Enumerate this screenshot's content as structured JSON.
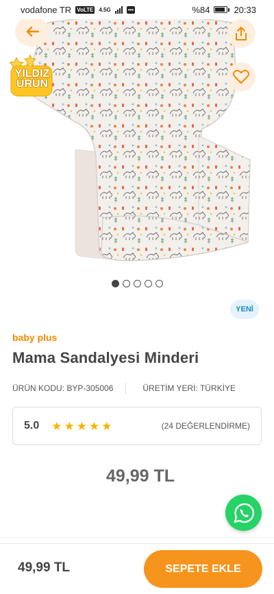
{
  "status_bar": {
    "carrier": "vodafone TR",
    "volte": "VoLTE",
    "network": "4.5G",
    "battery": "%84",
    "time": "20:33"
  },
  "header": {
    "back_icon": "arrow-left-icon",
    "share_icon": "share-icon",
    "favorite_icon": "heart-icon"
  },
  "badge": {
    "line1": "YILDIZ",
    "line2": "ÜRÜN"
  },
  "gallery": {
    "image_count": 5,
    "active_index": 0
  },
  "product": {
    "new_label": "YENİ",
    "brand": "baby plus",
    "name": "Mama Sandalyesi Minderi",
    "code": "ÜRÜN KODU: BYP-305006",
    "origin": "ÜRETİM YERİ: TÜRKİYE",
    "rating": "5.0",
    "stars": 5,
    "review_count": "(24 DEĞERLENDİRME)",
    "price": "49,99 TL"
  },
  "bottom_bar": {
    "price": "49,99 TL",
    "add_to_cart": "SEPETE EKLE"
  },
  "colors": {
    "accent": "#f7941d",
    "brand": "#f28a00",
    "whatsapp": "#25d366",
    "star": "#f7b500",
    "new_badge_text": "#1b86c9"
  }
}
